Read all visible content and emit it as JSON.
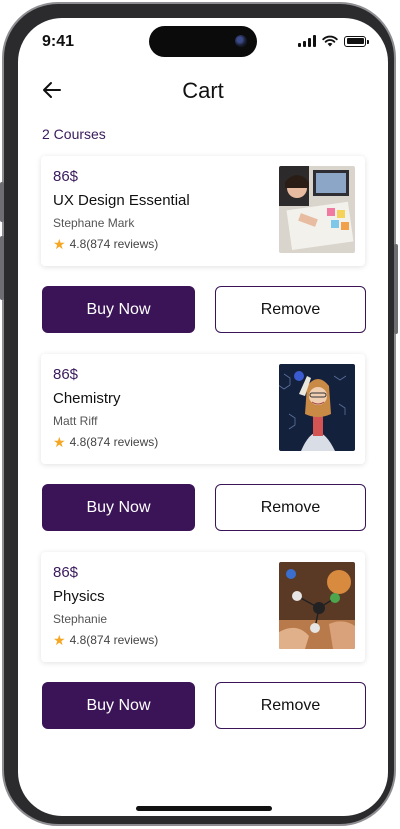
{
  "status": {
    "time": "9:41"
  },
  "header": {
    "title": "Cart",
    "back_icon": "arrow-left-icon"
  },
  "summary": {
    "count_label": "2 Courses"
  },
  "colors": {
    "primary": "#3a1456",
    "star": "#f5a623"
  },
  "items": [
    {
      "price": "86$",
      "title": "UX Design Essential",
      "author": "Stephane Mark",
      "rating": "4.8(874 reviews)",
      "buy_label": "Buy Now",
      "remove_label": "Remove"
    },
    {
      "price": "86$",
      "title": "Chemistry",
      "author": "Matt Riff",
      "rating": "4.8(874 reviews)",
      "buy_label": "Buy Now",
      "remove_label": "Remove"
    },
    {
      "price": "86$",
      "title": "Physics",
      "author": "Stephanie",
      "rating": "4.8(874 reviews)",
      "buy_label": "Buy Now",
      "remove_label": "Remove"
    }
  ]
}
